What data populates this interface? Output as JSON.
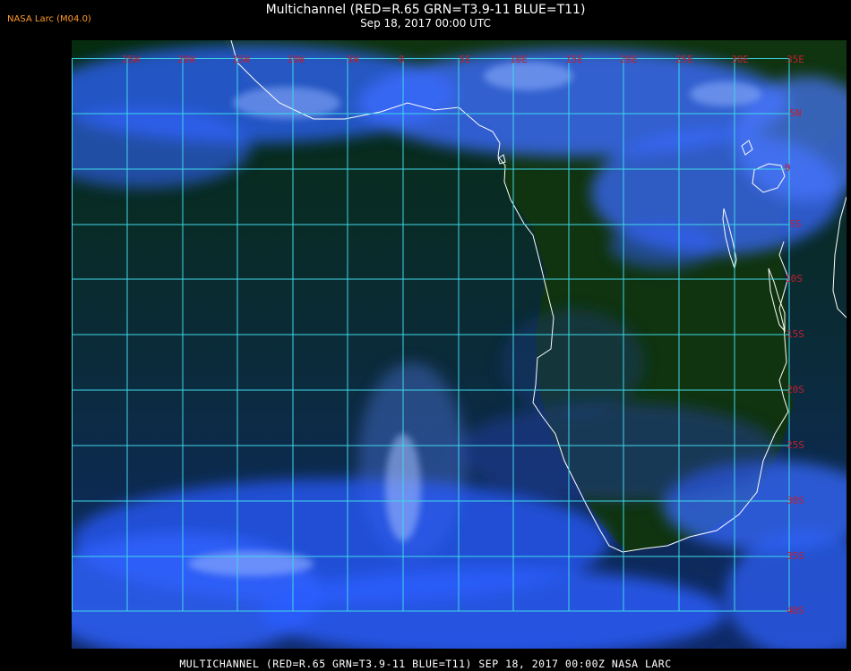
{
  "header": {
    "badge": "NASA Larc (M04.0)",
    "title": "Multichannel (RED=R.65 GRN=T3.9-11 BLUE=T11)",
    "subtitle": "Sep 18, 2017 00:00 UTC"
  },
  "map": {
    "lon_labels": [
      "25W",
      "20W",
      "15W",
      "10W",
      "5W",
      "0",
      "5E",
      "10E",
      "15E",
      "20E",
      "25E",
      "30E",
      "35E"
    ],
    "lat_labels": [
      "5N",
      "0",
      "5S",
      "10S",
      "15S",
      "20S",
      "25S",
      "30S",
      "35S",
      "40S"
    ],
    "colors": {
      "grid": "#3fd8e8",
      "label": "#c0202e",
      "coast": "#ffffff",
      "cloud": "#2f63ff",
      "ocean": "#0c2a4a",
      "land": "#143a12"
    }
  },
  "footer": {
    "caption": "MULTICHANNEL (RED=R.65 GRN=T3.9-11 BLUE=T11) SEP 18, 2017 00:00Z  NASA LARC"
  }
}
